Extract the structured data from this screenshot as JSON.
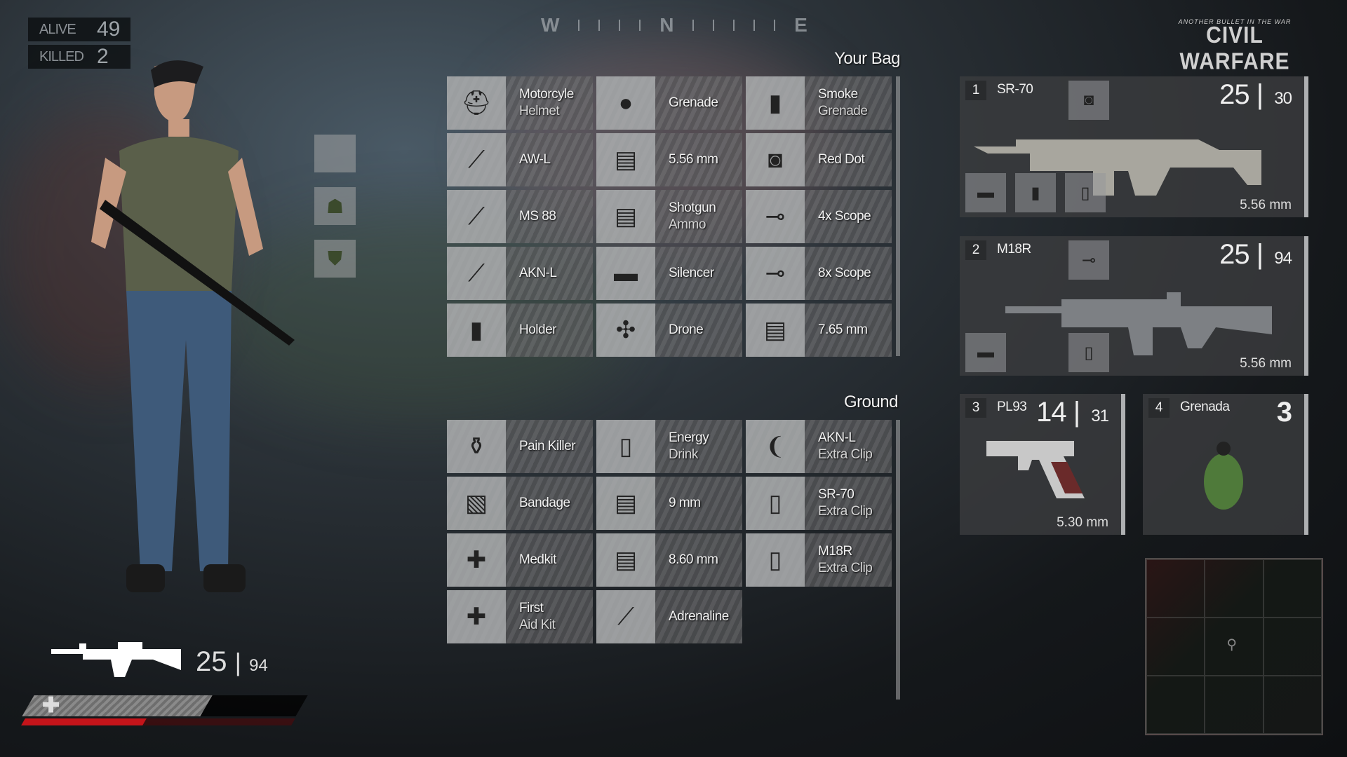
{
  "hud": {
    "alive_label": "ALIVE",
    "alive_value": "49",
    "killed_label": "KILLED",
    "killed_value": "2",
    "compass": [
      "W",
      "N",
      "E"
    ],
    "logo_tagline": "ANOTHER BULLET IN THE WAR",
    "logo_title": "CIVIL WARFARE",
    "current_ammo": "25",
    "reserve_ammo": "94",
    "health_fraction": 0.65,
    "stamina_fraction": 0.45
  },
  "colors": {
    "health_red": "#c4141a",
    "panel": "#3a3c3e",
    "accent_bar": "#aeb0b2"
  },
  "character_slots": [
    {
      "icon": "empty-slot"
    },
    {
      "icon": "backpack-icon"
    },
    {
      "icon": "vest-icon"
    }
  ],
  "bag": {
    "title": "Your Bag",
    "items": [
      {
        "l1": "Motorcyle",
        "l2": "Helmet",
        "icon": "helmet-icon",
        "g": "⛑"
      },
      {
        "l1": "Grenade",
        "l2": "",
        "icon": "grenade-icon",
        "g": "●"
      },
      {
        "l1": "Smoke",
        "l2": "Grenade",
        "icon": "smoke-grenade-icon",
        "g": "▮"
      },
      {
        "l1": "AW-L",
        "l2": "",
        "icon": "sniper-rifle-icon",
        "g": "⟋"
      },
      {
        "l1": "5.56 mm",
        "l2": "",
        "icon": "ammo-box-icon",
        "g": "▤"
      },
      {
        "l1": "Red Dot",
        "l2": "",
        "icon": "red-dot-sight-icon",
        "g": "◙"
      },
      {
        "l1": "MS 88",
        "l2": "",
        "icon": "shotgun-icon",
        "g": "⟋"
      },
      {
        "l1": "Shotgun",
        "l2": "Ammo",
        "icon": "shotgun-ammo-icon",
        "g": "▤"
      },
      {
        "l1": "4x Scope",
        "l2": "",
        "icon": "scope-icon",
        "g": "⊸"
      },
      {
        "l1": "AKN-L",
        "l2": "",
        "icon": "assault-rifle-icon",
        "g": "⟋"
      },
      {
        "l1": "Silencer",
        "l2": "",
        "icon": "silencer-icon",
        "g": "▬"
      },
      {
        "l1": "8x Scope",
        "l2": "",
        "icon": "scope-icon",
        "g": "⊸"
      },
      {
        "l1": "Holder",
        "l2": "",
        "icon": "grip-icon",
        "g": "▮"
      },
      {
        "l1": "Drone",
        "l2": "",
        "icon": "drone-icon",
        "g": "✣"
      },
      {
        "l1": "7.65 mm",
        "l2": "",
        "icon": "ammo-box-icon",
        "g": "▤"
      }
    ]
  },
  "ground": {
    "title": "Ground",
    "items": [
      {
        "l1": "Pain Killer",
        "l2": "",
        "icon": "pill-bottle-icon",
        "g": "⚱"
      },
      {
        "l1": "Energy",
        "l2": "Drink",
        "icon": "energy-drink-icon",
        "g": "▯"
      },
      {
        "l1": "AKN-L",
        "l2": "Extra Clip",
        "icon": "magazine-icon",
        "g": "❨"
      },
      {
        "l1": "Bandage",
        "l2": "",
        "icon": "bandage-icon",
        "g": "▧"
      },
      {
        "l1": "9 mm",
        "l2": "",
        "icon": "ammo-box-icon",
        "g": "▤"
      },
      {
        "l1": "SR-70",
        "l2": "Extra Clip",
        "icon": "magazine-icon",
        "g": "▯"
      },
      {
        "l1": "Medkit",
        "l2": "",
        "icon": "medkit-icon",
        "g": "✚"
      },
      {
        "l1": "8.60 mm",
        "l2": "",
        "icon": "ammo-box-icon",
        "g": "▤"
      },
      {
        "l1": "M18R",
        "l2": "Extra Clip",
        "icon": "magazine-icon",
        "g": "▯"
      },
      {
        "l1": "First",
        "l2": "Aid Kit",
        "icon": "first-aid-kit-icon",
        "g": "✚"
      },
      {
        "l1": "Adrenaline",
        "l2": "",
        "icon": "syringe-icon",
        "g": "⟋"
      }
    ]
  },
  "weapons": [
    {
      "slot": "1",
      "name": "SR-70",
      "ammo": "25",
      "reserve": "30",
      "caliber": "5.56 mm"
    },
    {
      "slot": "2",
      "name": "M18R",
      "ammo": "25",
      "reserve": "94",
      "caliber": "5.56 mm"
    },
    {
      "slot": "3",
      "name": "PL93",
      "ammo": "14",
      "reserve": "31",
      "caliber": "5.30 mm"
    },
    {
      "slot": "4",
      "name": "Grenada",
      "count": "3"
    }
  ]
}
